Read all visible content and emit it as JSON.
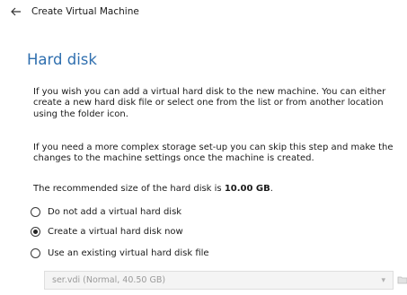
{
  "window": {
    "title": "Create Virtual Machine",
    "back_icon": "arrow-left-icon"
  },
  "page": {
    "heading": "Hard disk",
    "paragraph1": "If you wish you can add a virtual hard disk to the new machine. You can either create a new hard disk file or select one from the list or from another location using the folder icon.",
    "paragraph2": "If you need a more complex storage set-up you can skip this step and make the changes to the machine settings once the machine is created.",
    "recommended_prefix": "The recommended size of the hard disk is ",
    "recommended_size": "10.00 GB",
    "recommended_suffix": "."
  },
  "options": [
    {
      "label": "Do not add a virtual hard disk",
      "checked": false
    },
    {
      "label": "Create a virtual hard disk now",
      "checked": true
    },
    {
      "label": "Use an existing virtual hard disk file",
      "checked": false
    }
  ],
  "disk_select": {
    "value": "ser.vdi (Normal, 40.50 GB)",
    "enabled": false,
    "dropdown_icon": "chevron-down-icon",
    "folder_icon": "folder-icon"
  }
}
